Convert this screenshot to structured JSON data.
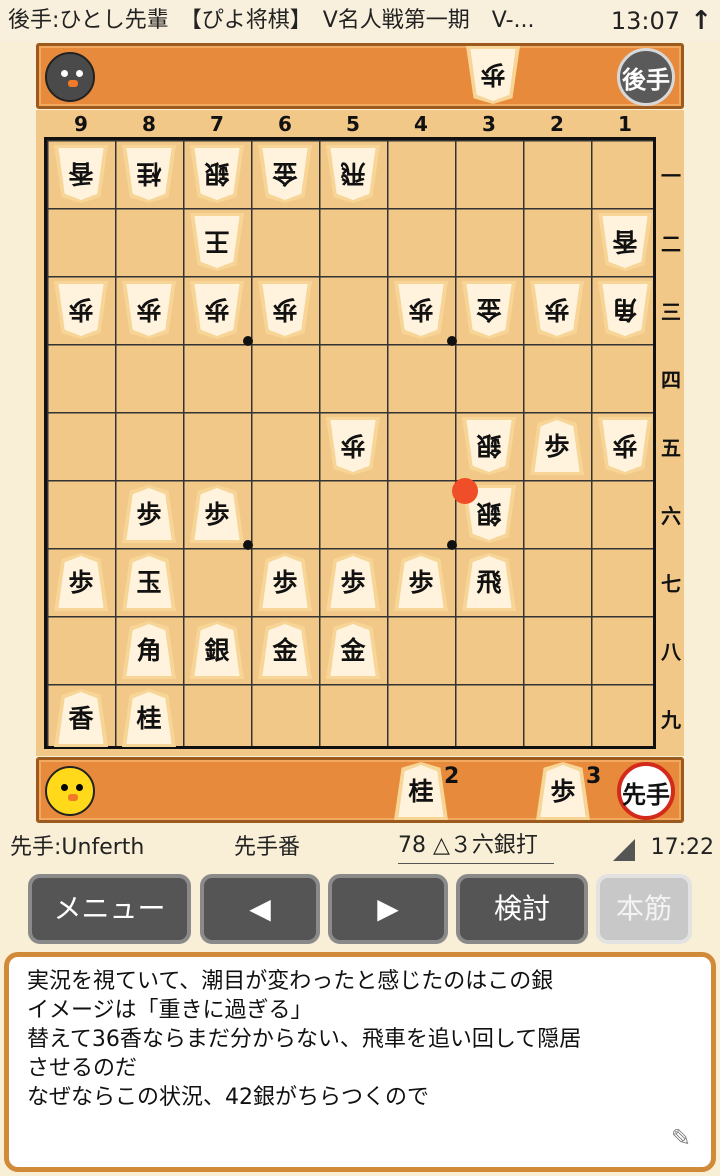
{
  "status_bar": {
    "title": "後手:ひとし先輩　【ぴよ将棋】　V名人戦第一期　V-...",
    "time": "13:07",
    "up_arrow": "↑"
  },
  "gote_hand": {
    "badge": "後手",
    "pieces": [
      {
        "label": "歩",
        "count": ""
      }
    ]
  },
  "sente_hand": {
    "badge": "先手",
    "pieces": [
      {
        "label": "桂",
        "count": "2"
      },
      {
        "label": "歩",
        "count": "3"
      }
    ]
  },
  "board": {
    "file_labels": [
      "9",
      "8",
      "7",
      "6",
      "5",
      "4",
      "3",
      "2",
      "1"
    ],
    "rank_labels": [
      "一",
      "二",
      "三",
      "四",
      "五",
      "六",
      "七",
      "八",
      "九"
    ],
    "last_move_marker": "3六",
    "pieces": [
      {
        "file": 9,
        "rank": 1,
        "label": "香",
        "owner": "gote"
      },
      {
        "file": 8,
        "rank": 1,
        "label": "桂",
        "owner": "gote"
      },
      {
        "file": 7,
        "rank": 1,
        "label": "銀",
        "owner": "gote"
      },
      {
        "file": 6,
        "rank": 1,
        "label": "金",
        "owner": "gote"
      },
      {
        "file": 5,
        "rank": 1,
        "label": "飛",
        "owner": "gote"
      },
      {
        "file": 7,
        "rank": 2,
        "label": "王",
        "owner": "gote"
      },
      {
        "file": 1,
        "rank": 2,
        "label": "香",
        "owner": "gote"
      },
      {
        "file": 9,
        "rank": 3,
        "label": "歩",
        "owner": "gote"
      },
      {
        "file": 8,
        "rank": 3,
        "label": "歩",
        "owner": "gote"
      },
      {
        "file": 7,
        "rank": 3,
        "label": "歩",
        "owner": "gote"
      },
      {
        "file": 6,
        "rank": 3,
        "label": "歩",
        "owner": "gote"
      },
      {
        "file": 4,
        "rank": 3,
        "label": "歩",
        "owner": "gote"
      },
      {
        "file": 3,
        "rank": 3,
        "label": "金",
        "owner": "gote"
      },
      {
        "file": 2,
        "rank": 3,
        "label": "歩",
        "owner": "gote"
      },
      {
        "file": 1,
        "rank": 3,
        "label": "角",
        "owner": "gote"
      },
      {
        "file": 5,
        "rank": 5,
        "label": "歩",
        "owner": "gote"
      },
      {
        "file": 3,
        "rank": 5,
        "label": "銀",
        "owner": "gote"
      },
      {
        "file": 2,
        "rank": 5,
        "label": "歩",
        "owner": "sente"
      },
      {
        "file": 1,
        "rank": 5,
        "label": "歩",
        "owner": "gote"
      },
      {
        "file": 8,
        "rank": 6,
        "label": "歩",
        "owner": "sente"
      },
      {
        "file": 7,
        "rank": 6,
        "label": "歩",
        "owner": "sente"
      },
      {
        "file": 3,
        "rank": 6,
        "label": "銀",
        "owner": "gote"
      },
      {
        "file": 9,
        "rank": 7,
        "label": "歩",
        "owner": "sente"
      },
      {
        "file": 8,
        "rank": 7,
        "label": "玉",
        "owner": "sente"
      },
      {
        "file": 6,
        "rank": 7,
        "label": "歩",
        "owner": "sente"
      },
      {
        "file": 5,
        "rank": 7,
        "label": "歩",
        "owner": "sente"
      },
      {
        "file": 4,
        "rank": 7,
        "label": "歩",
        "owner": "sente"
      },
      {
        "file": 3,
        "rank": 7,
        "label": "飛",
        "owner": "sente"
      },
      {
        "file": 8,
        "rank": 8,
        "label": "角",
        "owner": "sente"
      },
      {
        "file": 7,
        "rank": 8,
        "label": "銀",
        "owner": "sente"
      },
      {
        "file": 6,
        "rank": 8,
        "label": "金",
        "owner": "sente"
      },
      {
        "file": 5,
        "rank": 8,
        "label": "金",
        "owner": "sente"
      },
      {
        "file": 9,
        "rank": 9,
        "label": "香",
        "owner": "sente"
      },
      {
        "file": 8,
        "rank": 9,
        "label": "桂",
        "owner": "sente"
      }
    ]
  },
  "info_bar": {
    "sente_name": "先手:Unferth",
    "turn": "先手番",
    "move": "78 △３六銀打",
    "clock": "17:22"
  },
  "buttons": [
    {
      "id": "menu",
      "label": "メニュー",
      "enabled": true
    },
    {
      "id": "prev",
      "label": "◀",
      "enabled": true
    },
    {
      "id": "next",
      "label": "▶",
      "enabled": true
    },
    {
      "id": "analyze",
      "label": "検討",
      "enabled": true
    },
    {
      "id": "mainline",
      "label": "本筋",
      "enabled": false
    }
  ],
  "comment": {
    "lines": [
      "実況を視ていて、潮目が変わったと感じたのはこの銀",
      "イメージは「重きに過ぎる」",
      "替えて36香ならまだ分からない、飛車を追い回して隠居",
      "させるのだ",
      "なぜならこの状況、42銀がちらつくので"
    ]
  }
}
